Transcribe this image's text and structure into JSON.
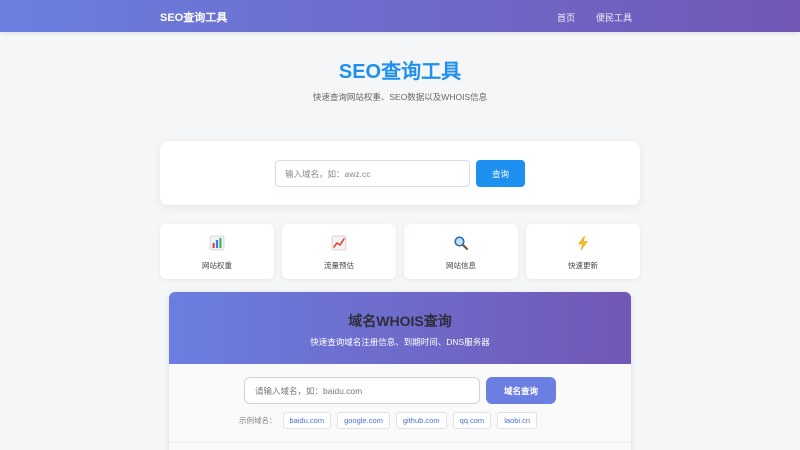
{
  "nav": {
    "brand": "SEO查询工具",
    "links": [
      {
        "label": "首页"
      },
      {
        "label": "便民工具"
      }
    ]
  },
  "hero": {
    "title": "SEO查询工具",
    "subtitle": "快速查询网站权重、SEO数据以及WHOIS信息"
  },
  "search": {
    "placeholder": "输入域名，如：awz.cc",
    "value": "",
    "button_label": "查询"
  },
  "features": [
    {
      "label": "网站权重",
      "icon": "bar-chart-icon"
    },
    {
      "label": "流量预估",
      "icon": "trend-chart-icon"
    },
    {
      "label": "网站信息",
      "icon": "magnifier-icon"
    },
    {
      "label": "快速更新",
      "icon": "lightning-icon"
    }
  ],
  "whois": {
    "title": "域名WHOIS查询",
    "subtitle": "快速查询域名注册信息、到期时间、DNS服务器",
    "placeholder": "请输入域名，如：baidu.com",
    "value": "",
    "button_label": "域名查询",
    "examples_label": "示例域名：",
    "examples": [
      "baidu.com",
      "google.com",
      "github.com",
      "qq.com",
      "laobi.cn"
    ]
  },
  "colors": {
    "accent": "#1e90f0",
    "gradient_start": "#6a7fe0",
    "gradient_end": "#7257b5",
    "whois_button": "#6b7fe3"
  }
}
